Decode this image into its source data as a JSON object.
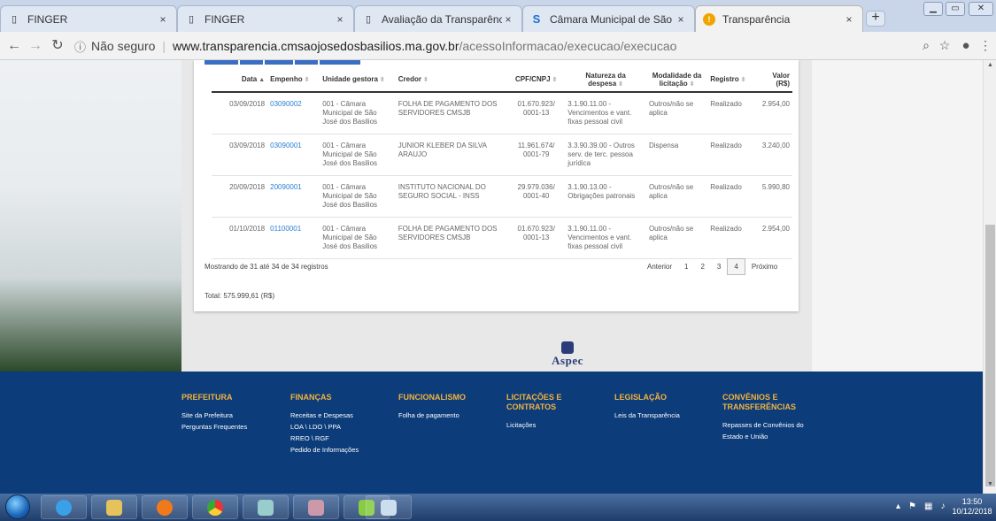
{
  "browser": {
    "tabs": [
      {
        "title": "FINGER",
        "icon": "page-icon",
        "close": "×"
      },
      {
        "title": "FINGER",
        "icon": "page-icon",
        "close": "×"
      },
      {
        "title": "Avaliação da Transparência do",
        "icon": "page-icon",
        "close": "×"
      },
      {
        "title": "Câmara Municipal de São José",
        "icon": "s-logo-icon",
        "close": "×"
      },
      {
        "title": "Transparência",
        "icon": "warning-icon",
        "close": "×"
      }
    ],
    "new_tab": "+",
    "security": "Não seguro",
    "url_host": "www.transparencia.cmsaojosedosbasilios.ma.gov.br",
    "url_path": "/acessoInformacao/execucao/execucao"
  },
  "table": {
    "headers": [
      "Data",
      "Empenho",
      "Unidade gestora",
      "Credor",
      "CPF/CNPJ",
      "Natureza da despesa",
      "Modalidade da licitação",
      "Registro",
      "Valor (R$)"
    ],
    "rows": [
      {
        "data": "03/09/2018",
        "empenho": "03090002",
        "unidade": "001 - Câmara Municipal de São José dos Basilios",
        "credor": "FOLHA DE PAGAMENTO DOS SERVIDORES CMSJB",
        "cnpj": "01.670.923/ 0001-13",
        "natureza": "3.1.90.11.00 - Vencimentos e vant. fixas pessoal civil",
        "modalidade": "Outros/não se aplica",
        "registro": "Realizado",
        "valor": "2.954,00"
      },
      {
        "data": "03/09/2018",
        "empenho": "03090001",
        "unidade": "001 - Câmara Municipal de São José dos Basilios",
        "credor": "JUNIOR KLEBER DA SILVA ARAUJO",
        "cnpj": "11.961.674/ 0001-79",
        "natureza": "3.3.90.39.00 - Outros serv. de terc. pessoa jurídica",
        "modalidade": "Dispensa",
        "registro": "Realizado",
        "valor": "3.240,00"
      },
      {
        "data": "20/09/2018",
        "empenho": "20090001",
        "unidade": "001 - Câmara Municipal de São José dos Basilios",
        "credor": "INSTITUTO NACIONAL DO SEGURO SOCIAL - INSS",
        "cnpj": "29.979.036/ 0001-40",
        "natureza": "3.1.90.13.00 - Obrigações patronais",
        "modalidade": "Outros/não se aplica",
        "registro": "Realizado",
        "valor": "5.990,80"
      },
      {
        "data": "01/10/2018",
        "empenho": "01100001",
        "unidade": "001 - Câmara Municipal de São José dos Basilios",
        "credor": "FOLHA DE PAGAMENTO DOS SERVIDORES CMSJB",
        "cnpj": "01.670.923/ 0001-13",
        "natureza": "3.1.90.11.00 - Vencimentos e vant. fixas pessoal civil",
        "modalidade": "Outros/não se aplica",
        "registro": "Realizado",
        "valor": "2.954,00"
      }
    ]
  },
  "info": "Mostrando de 31 até 34 de 34 registros",
  "pager": {
    "prev": "Anterior",
    "pages": [
      "1",
      "2",
      "3",
      "4"
    ],
    "current": "4",
    "next": "Próximo"
  },
  "total": "Total: 575.999,61 (R$)",
  "logo_text": "Aspec",
  "footer": [
    {
      "title": "PREFEITURA",
      "links": [
        "Site da Prefeitura",
        "Perguntas Frequentes"
      ]
    },
    {
      "title": "FINANÇAS",
      "links": [
        "Receitas e Despesas",
        "LOA \\ LDO \\ PPA",
        "RREO \\ RGF",
        "Pedido de Informações"
      ]
    },
    {
      "title": "FUNCIONALISMO",
      "links": [
        "Folha de pagamento"
      ]
    },
    {
      "title": "LICITAÇÕES E CONTRATOS",
      "links": [
        "Licitações"
      ]
    },
    {
      "title": "LEGISLAÇÃO",
      "links": [
        "Leis da Transparência"
      ]
    },
    {
      "title": "CONVÊNIOS E TRANSFERÊNCIAS",
      "links": [
        "Repasses de Convênios do Estado e União"
      ]
    }
  ],
  "clock": {
    "time": "13:50",
    "date": "10/12/2018"
  },
  "colors": {
    "footer_bg": "#0c3c7a",
    "footer_heading": "#f3b33d",
    "link": "#2a7fd1"
  }
}
